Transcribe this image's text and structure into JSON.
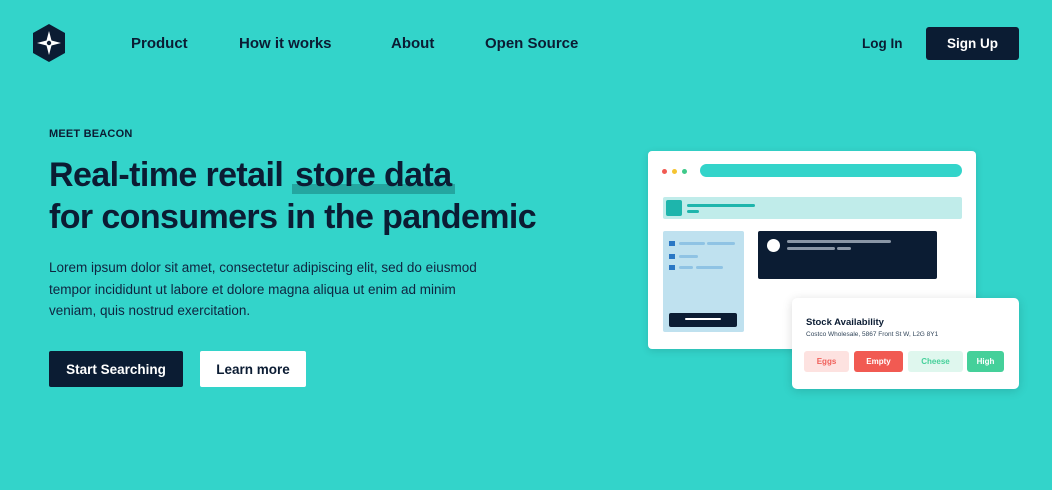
{
  "header": {
    "logo_icon": "compass-star-icon",
    "nav": [
      {
        "label": "Product"
      },
      {
        "label": "How it works"
      },
      {
        "label": "About"
      },
      {
        "label": "Open Source"
      }
    ],
    "login_label": "Log In",
    "signup_label": "Sign Up"
  },
  "hero": {
    "eyebrow": "MEET BEACON",
    "headline_part1": "Real-time retail ",
    "headline_highlight": "store data",
    "headline_part2": "for consumers in the pandemic",
    "body": "Lorem ipsum dolor sit amet, consectetur adipiscing elit, sed do eiusmod tempor incididunt ut labore et dolore magna aliqua ut enim ad minim veniam, quis nostrud exercitation.",
    "primary_button": "Start Searching",
    "secondary_button": "Learn more"
  },
  "illustration": {
    "stock_card": {
      "title": "Stock Availability",
      "subtitle": "Costco Wholesale, 5867 Front St W, L2G 8Y1",
      "tags": [
        {
          "label": "Eggs",
          "bg": "#fde2e0",
          "fg": "#f0605a"
        },
        {
          "label": "Empty",
          "bg": "#f15a52",
          "fg": "#ffffff"
        },
        {
          "label": "Cheese",
          "bg": "#dff7ee",
          "fg": "#45d09a"
        },
        {
          "label": "High",
          "bg": "#45d09a",
          "fg": "#ffffff"
        }
      ]
    }
  },
  "colors": {
    "background": "#33d4ca",
    "navy": "#0b1c33",
    "white": "#ffffff"
  }
}
